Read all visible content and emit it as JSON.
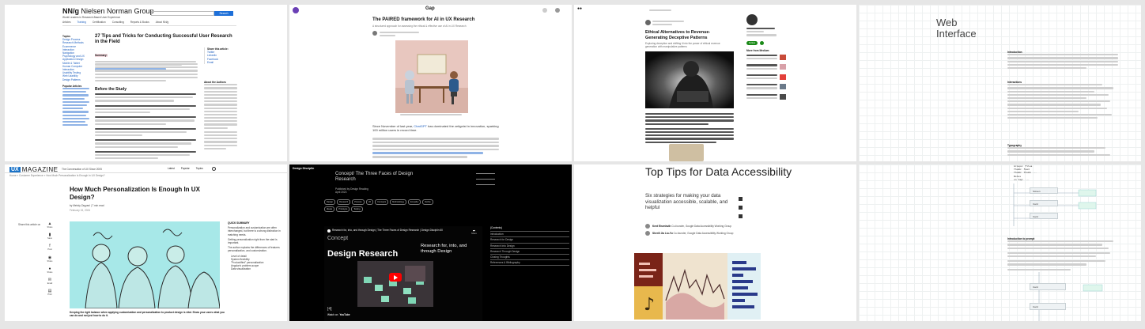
{
  "nng": {
    "logo_mark": "NN/g",
    "logo_text": "Nielsen Norman Group",
    "tagline": "World Leaders in Research-Based User Experience",
    "search_button": "Search",
    "nav": [
      "Articles",
      "Training",
      "Certification",
      "Consulting",
      "Reports & Books",
      "About NN/g"
    ],
    "topics_heading": "Topics",
    "topics": [
      "Design Process",
      "Research Methods",
      "Ecommerce",
      "Interaction",
      "Navigation",
      "Psychology and UX",
      "Application Design",
      "Mobile & Tablet",
      "Human Computer Interaction",
      "Usability Testing",
      "Web Usability",
      "Design Patterns"
    ],
    "popular_heading": "Popular Articles",
    "article_title": "27 Tips and Tricks for Conducting Successful User Research in the Field",
    "summary_label": "Summary:",
    "section_heading": "Before the Study",
    "share_heading": "Share this article:",
    "share_items": [
      "Twitter",
      "LinkedIn",
      "Facebook",
      "Email"
    ],
    "about_heading": "About the Authors"
  },
  "gap": {
    "logo": "Gap",
    "title": "The PAIRED framework for AI in UX Research",
    "subtitle": "A structured approach for assessing the ethical & effective use of AI in UX Research",
    "paragraph_intro": "Since November of last year,",
    "paragraph_link": "ChatGPT",
    "paragraph_rest": "has dominated the zeitgeist in innovation, sparking 100 million users in record time."
  },
  "medium": {
    "title": "Ethical Alternatives to Revenue-Generating Deceptive Patterns",
    "subtitle": "Exploring deception and shifting it into the power of ethical revenue generation with manipulative patterns",
    "follow_button": "Follow",
    "more_from": "More from Medium"
  },
  "web_interface": {
    "title_line1": "Web",
    "title_line2": "Interface",
    "intro_heading": "Introduction",
    "section_heading": "Interactions",
    "note_heading": "Typography"
  },
  "uxmag": {
    "logo_box": "UX",
    "logo_text": "MAGAZINE",
    "tagline": "The Conversation of UX Since 2005",
    "nav": [
      "Latest",
      "Popular",
      "Topics"
    ],
    "breadcrumb": "Home » Customer Experience » How Much Personalization Is Enough In UX Design?",
    "title": "How Much Personalization Is Enough In UX Design?",
    "byline": "by Mehdy Zayyani  |  7 min read",
    "date": "February 15, 2024",
    "share_label": "Share this article on",
    "share_items": [
      "Share",
      "Save",
      "Post",
      "Share",
      "Share",
      "Email",
      "Print"
    ],
    "summary_heading": "QUICK SUMMARY",
    "summary_items": [
      "Personalization and customization are often interchanged, but there is a strong distinction in matching needs.",
      "Getting personalization right from the start is important.",
      "The author explains the differences of features personalization, and customization.",
      "Level of detail",
      "System flexibility",
      "\"Productified\" personalization",
      "Angular's problem-scope",
      "Data visualization"
    ],
    "footer_text": "Keeping the right balance when applying customization and personalization to product design is vital. Show your users what you can do and not just how to do it."
  },
  "concept": {
    "logo": "Design Disciplin",
    "header": "Concept/ The Three Faces of Design Research",
    "meta_lines": [
      "Published by Design Reading",
      "April 2023"
    ],
    "tags": [
      "Design",
      "Research",
      "Process",
      "UX",
      "Concepts",
      "Methodology",
      "Empathy",
      "Define",
      "Ideate",
      "Prototype",
      "Testing"
    ],
    "video_title": "Research for, into, and through Design | The Three Faces of Design Research | Design Disciplin 60",
    "video_share": "Share",
    "concept_label": "Concept",
    "big_title": "Design Research",
    "tagline": "Research for, into, and through Design",
    "contents_heading": "(Contents)",
    "contents": [
      "Introduction",
      "Research for Design",
      "Research Into Design",
      "Research Through Design",
      "Closing Thoughts",
      "References & Bibliography"
    ],
    "counter": "[4]",
    "watch_label": "Watch on",
    "watch_brand": "YouTube"
  },
  "data_access": {
    "title": "Top Tips for Data Accessibility",
    "subtitle": "Six strategies for making your data visualization accessible, scalable, and helpful",
    "author1": "Kent Eisenhuth",
    "author1_role": "Co-founder, Google Data Accessibility Working Group",
    "author2": "Sherill Jia Liu-Yu",
    "author2_role": "Co-founder, Google Data Accessibility Working Group"
  },
  "flow": {
    "code_lines": [
      "Groups: Files",
      "Thumb: Feed",
      "Thumb: Thumb ...",
      "Notes",
      "on tap: ..."
    ],
    "nodes": [
      "Screen",
      "Card",
      "Card",
      "Card",
      "Card"
    ],
    "para_heading": "Introduction to prompt"
  }
}
